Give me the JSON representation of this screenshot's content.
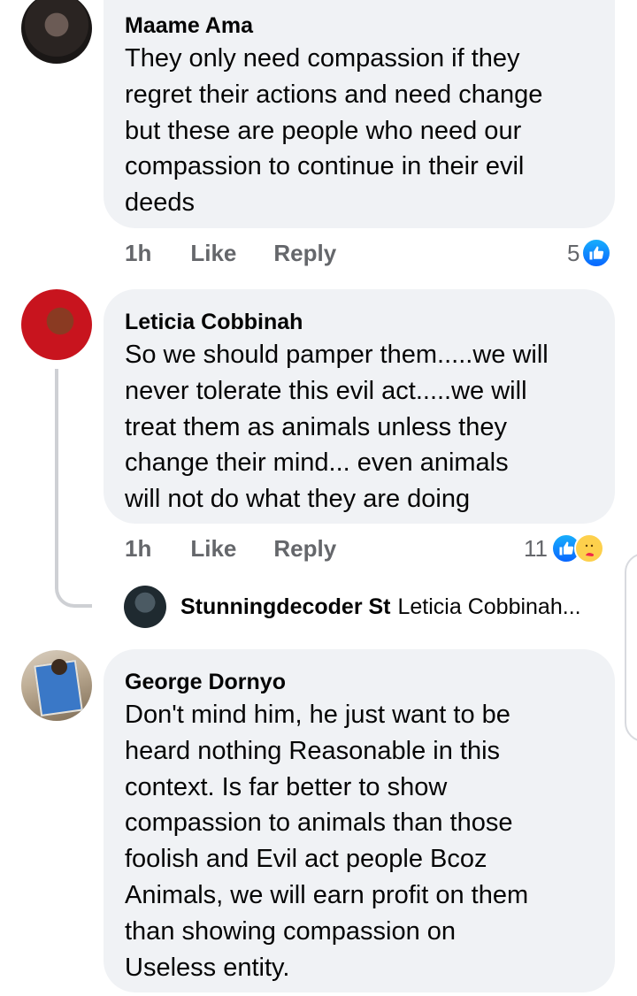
{
  "comments": [
    {
      "author": "Maame Ama",
      "text": "They only need compassion if they\nregret their actions and need change\nbut these are people who need our\ncompassion to continue in their evil\ndeeds",
      "time": "1h",
      "like_label": "Like",
      "reply_label": "Reply",
      "reaction_count": "5"
    },
    {
      "author": "Leticia Cobbinah",
      "text": "So we should pamper them.....we will\nnever  tolerate this evil act.....we  will\ntreat them as animals unless they\nchange their mind... even animals\nwill not do what they are doing",
      "time": "1h",
      "like_label": "Like",
      "reply_label": "Reply",
      "reaction_count": "11",
      "reply_preview": {
        "author": "Stunningdecoder St",
        "text": "Leticia Cobbinah..."
      }
    },
    {
      "author": "George Dornyo",
      "text": "Don't mind him, he just want to be\nheard nothing Reasonable in this\ncontext. Is far better to show\ncompassion to animals than those\nfoolish and Evil act people Bcoz\nAnimals, we will earn profit on them\nthan showing compassion  on\nUseless entity."
    }
  ],
  "icons": {
    "like_reaction": "like-reaction-icon",
    "care_reaction": "care-reaction-icon"
  },
  "colors": {
    "bubble": "#f0f2f5",
    "meta_text": "#65676b",
    "like_blue": "#0866ff",
    "care_yellow": "#fdd04c"
  }
}
